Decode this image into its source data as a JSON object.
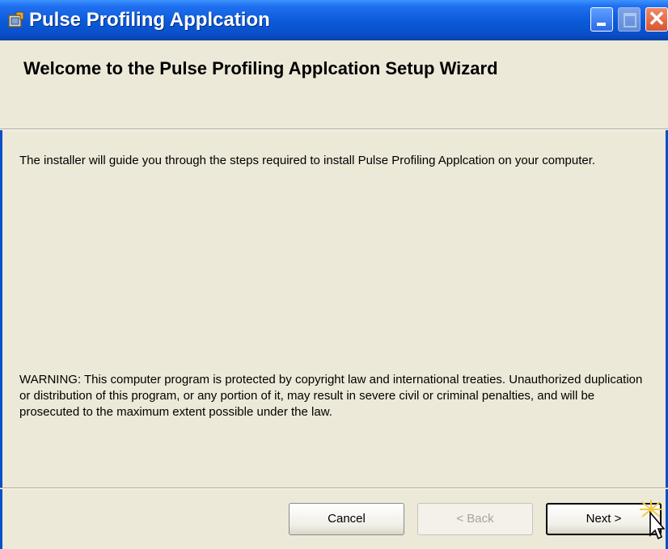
{
  "window": {
    "title": "Pulse Profiling Applcation",
    "controls": {
      "minimize": "_",
      "maximize": "□",
      "close": "✕"
    }
  },
  "header": {
    "title": "Welcome to the Pulse Profiling Applcation Setup Wizard"
  },
  "body": {
    "intro": "The installer will guide you through the steps required to install Pulse Profiling Applcation on your computer.",
    "warning": "WARNING: This computer program is protected by copyright law and international treaties. Unauthorized duplication or distribution of this program, or any portion of it, may result in severe civil or criminal penalties, and will be prosecuted to the maximum extent possible under the law."
  },
  "buttons": {
    "cancel": "Cancel",
    "back": "< Back",
    "next": "Next >"
  },
  "icons": {
    "app_icon": "installer-icon",
    "cursor": "arrow-cursor-icon"
  }
}
